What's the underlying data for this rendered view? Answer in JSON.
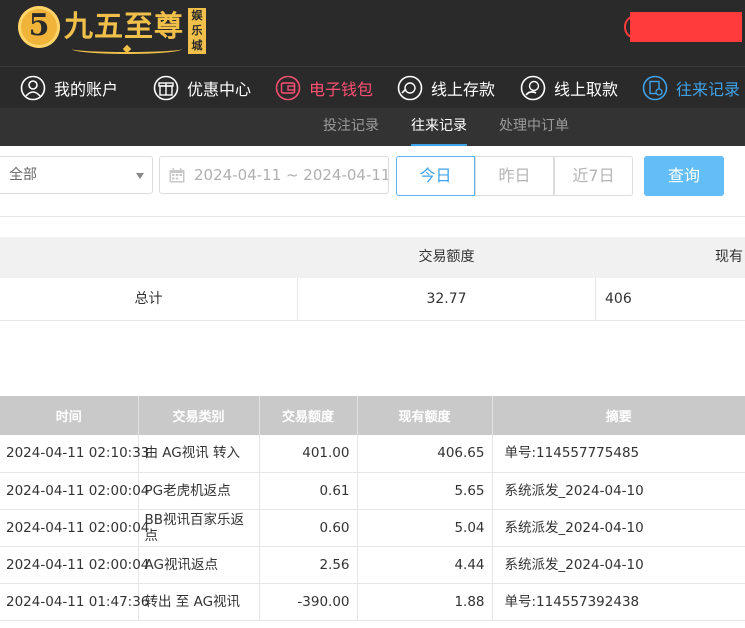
{
  "brand": {
    "logo_digit": "5",
    "title": "九五至尊",
    "badge": "娱乐城"
  },
  "nav": {
    "items": [
      {
        "label": "我的账户",
        "icon": "user-icon"
      },
      {
        "label": "优惠中心",
        "icon": "gift-icon"
      },
      {
        "label": "电子钱包",
        "icon": "wallet-icon"
      },
      {
        "label": "线上存款",
        "icon": "deposit-icon"
      },
      {
        "label": "线上取款",
        "icon": "withdraw-icon"
      },
      {
        "label": "往来记录",
        "icon": "records-icon"
      }
    ],
    "colors": {
      "accent_pink": "#ff4f72",
      "accent_blue": "#3fa2e8"
    }
  },
  "subnav": {
    "tabs": [
      {
        "label": "投注记录"
      },
      {
        "label": "往来记录",
        "active": true
      },
      {
        "label": "处理中订单"
      }
    ]
  },
  "filter": {
    "type_select": "全部",
    "date_range": "2024-04-11 ~ 2024-04-11",
    "quick": [
      "今日",
      "昨日",
      "近7日"
    ],
    "search_label": "查询"
  },
  "summary": {
    "headers": [
      "交易额度",
      "现有"
    ],
    "row": {
      "label": "总计",
      "amount": "32.77",
      "balance": "406"
    }
  },
  "records": {
    "headers": [
      "时间",
      "交易类别",
      "交易额度",
      "现有额度",
      "摘要"
    ],
    "rows": [
      {
        "time": "2024-04-11 02:10:33",
        "type": "由 AG视讯 转入",
        "amount": "401.00",
        "balance": "406.65",
        "summary": "单号:114557775485"
      },
      {
        "time": "2024-04-11 02:00:04",
        "type": "PG老虎机返点",
        "amount": "0.61",
        "balance": "5.65",
        "summary": "系统派发_2024-04-10"
      },
      {
        "time": "2024-04-11 02:00:04",
        "type": "BB视讯百家乐返点",
        "amount": "0.60",
        "balance": "5.04",
        "summary": "系统派发_2024-04-10"
      },
      {
        "time": "2024-04-11 02:00:04",
        "type": "AG视讯返点",
        "amount": "2.56",
        "balance": "4.44",
        "summary": "系统派发_2024-04-10"
      },
      {
        "time": "2024-04-11 01:47:36",
        "type": "转出 至 AG视讯",
        "amount": "-390.00",
        "balance": "1.88",
        "summary": "单号:114557392438"
      }
    ]
  }
}
